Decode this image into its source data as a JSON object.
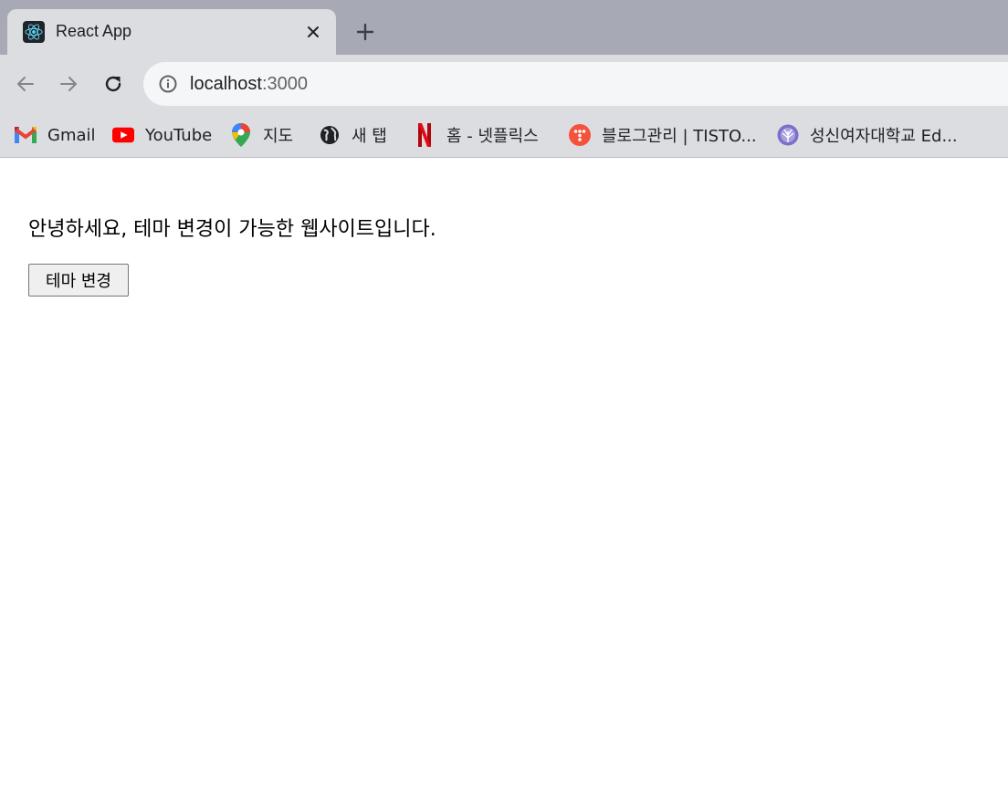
{
  "browser": {
    "tab": {
      "title": "React App",
      "favicon": "react-logo-icon",
      "close_icon": "close-icon"
    },
    "new_tab_icon": "plus-icon",
    "toolbar": {
      "back_icon": "arrow-left-icon",
      "forward_icon": "arrow-right-icon",
      "reload_icon": "reload-icon",
      "info_icon": "info-circle-icon",
      "url_host": "localhost",
      "url_port": ":3000"
    },
    "bookmarks": [
      {
        "label": "Gmail",
        "icon": "gmail-icon"
      },
      {
        "label": "YouTube",
        "icon": "youtube-icon"
      },
      {
        "label": "지도",
        "icon": "google-maps-pin-icon"
      },
      {
        "label": "새 탭",
        "icon": "globe-icon"
      },
      {
        "label": "홈 - 넷플릭스",
        "icon": "netflix-icon"
      },
      {
        "label": "블로그관리 | TISTO...",
        "icon": "tistory-icon"
      },
      {
        "label": "성신여자대학교 Ed...",
        "icon": "university-logo-icon"
      }
    ]
  },
  "page": {
    "greeting": "안녕하세요, 테마 변경이 가능한 웹사이트입니다.",
    "theme_button_label": "테마 변경"
  },
  "colors": {
    "tabstrip_bg": "#a7aab4",
    "toolbar_bg": "#dcdde1",
    "omnibox_bg": "#f5f6f8",
    "page_bg": "#ffffff",
    "button_bg": "#efefef",
    "button_border": "#767676"
  }
}
